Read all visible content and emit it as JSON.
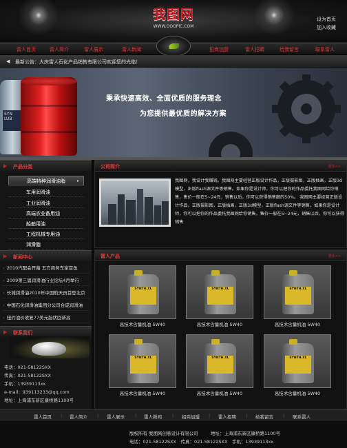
{
  "header": {
    "logo_text": "我图网",
    "logo_url": "WWW.OOOPIC.COM",
    "links": [
      "设为首页",
      "加入收藏"
    ]
  },
  "nav": {
    "left": [
      "雷人首页",
      "雷人简介",
      "雷人展示",
      "雷人新闻"
    ],
    "right": [
      "招商加盟",
      "雷人招聘",
      "给我留言",
      "联系雷人"
    ]
  },
  "notice": {
    "icon": "speaker-icon",
    "text": "最新公告：大庆雷人石化产品销售有限公司欢迎您的光临！"
  },
  "banner": {
    "line1": "秉承快速高效、全面优质的服务理念",
    "line2": "为您提供最优质的解决方案"
  },
  "sidebar": {
    "categories_title": "产品分类",
    "categories": [
      "高端特种润滑油脂",
      "车用润滑油",
      "工业润滑油",
      "高端农业备用油",
      "船舶用油",
      "工程机械专用油",
      "润滑脂"
    ],
    "news_title": "新闻中心",
    "news": [
      "2010汽配会开幕 五方商务东家首鱼",
      "2009第三届润滑油行业论坛4月举行",
      "长城润滑油2010年中国航天员首登北京",
      "中国石化润滑油集团分公司合成润滑油",
      "纽约油价收复77美元起伏回新高"
    ],
    "contact_title": "联系我们",
    "contact": [
      "电话：021-58122SXX",
      "传真：021-58122SXX",
      "手机：13939113xx",
      "e-mail：939113233@qq.com",
      "地址：上海浦东新区康桥路1100号"
    ]
  },
  "about": {
    "title": "公司简介",
    "more": "更多>>",
    "paragraph": "我图网，我设计我赚钱。我图网主要经营正版设计作品，正版摄影图，正版插画，正版3d模型，正版flash源文件等销售。如果你是设计师，你可以把你的作品委托我图网给你销售，售价一般在5~24元，销售以后，你可以获得销售额的50%。 我图网主要经营正版设计作品，正版摄影图，正版插画，正版3d模型，正版flash源文件等销售。如果你是设计师，你可以把你的作品委托我图网给你销售，售价一般在5~24元，销售以后，你可以获得销售"
  },
  "products": {
    "title": "雷人产品",
    "more": "更多>>",
    "items": [
      "高技术含量机油 5W40",
      "高技术含量机油 5W40",
      "高技术含量机油 5W40",
      "高技术含量机油 5W40",
      "高技术含量机油 5W40",
      "高技术含量机油 5W40"
    ],
    "label_text": "SYNTH.XL"
  },
  "footer": {
    "nav": [
      "雷人首页",
      "雷人简介",
      "雷人展示",
      "雷人新闻",
      "招商加盟",
      "雷人招聘",
      "给我留言",
      "联系雷人"
    ],
    "line1a": "版权所有 我图网创意设计有限公司",
    "line1b": "地址：上海浦东新区康桥路1100号",
    "line2": "电话：021-58122SXX　传真：021-58122SXX　手机：13939113xx"
  },
  "colors": {
    "accent": "#e63a3a",
    "background": "#0c0c0c",
    "drum": "#e02121"
  }
}
